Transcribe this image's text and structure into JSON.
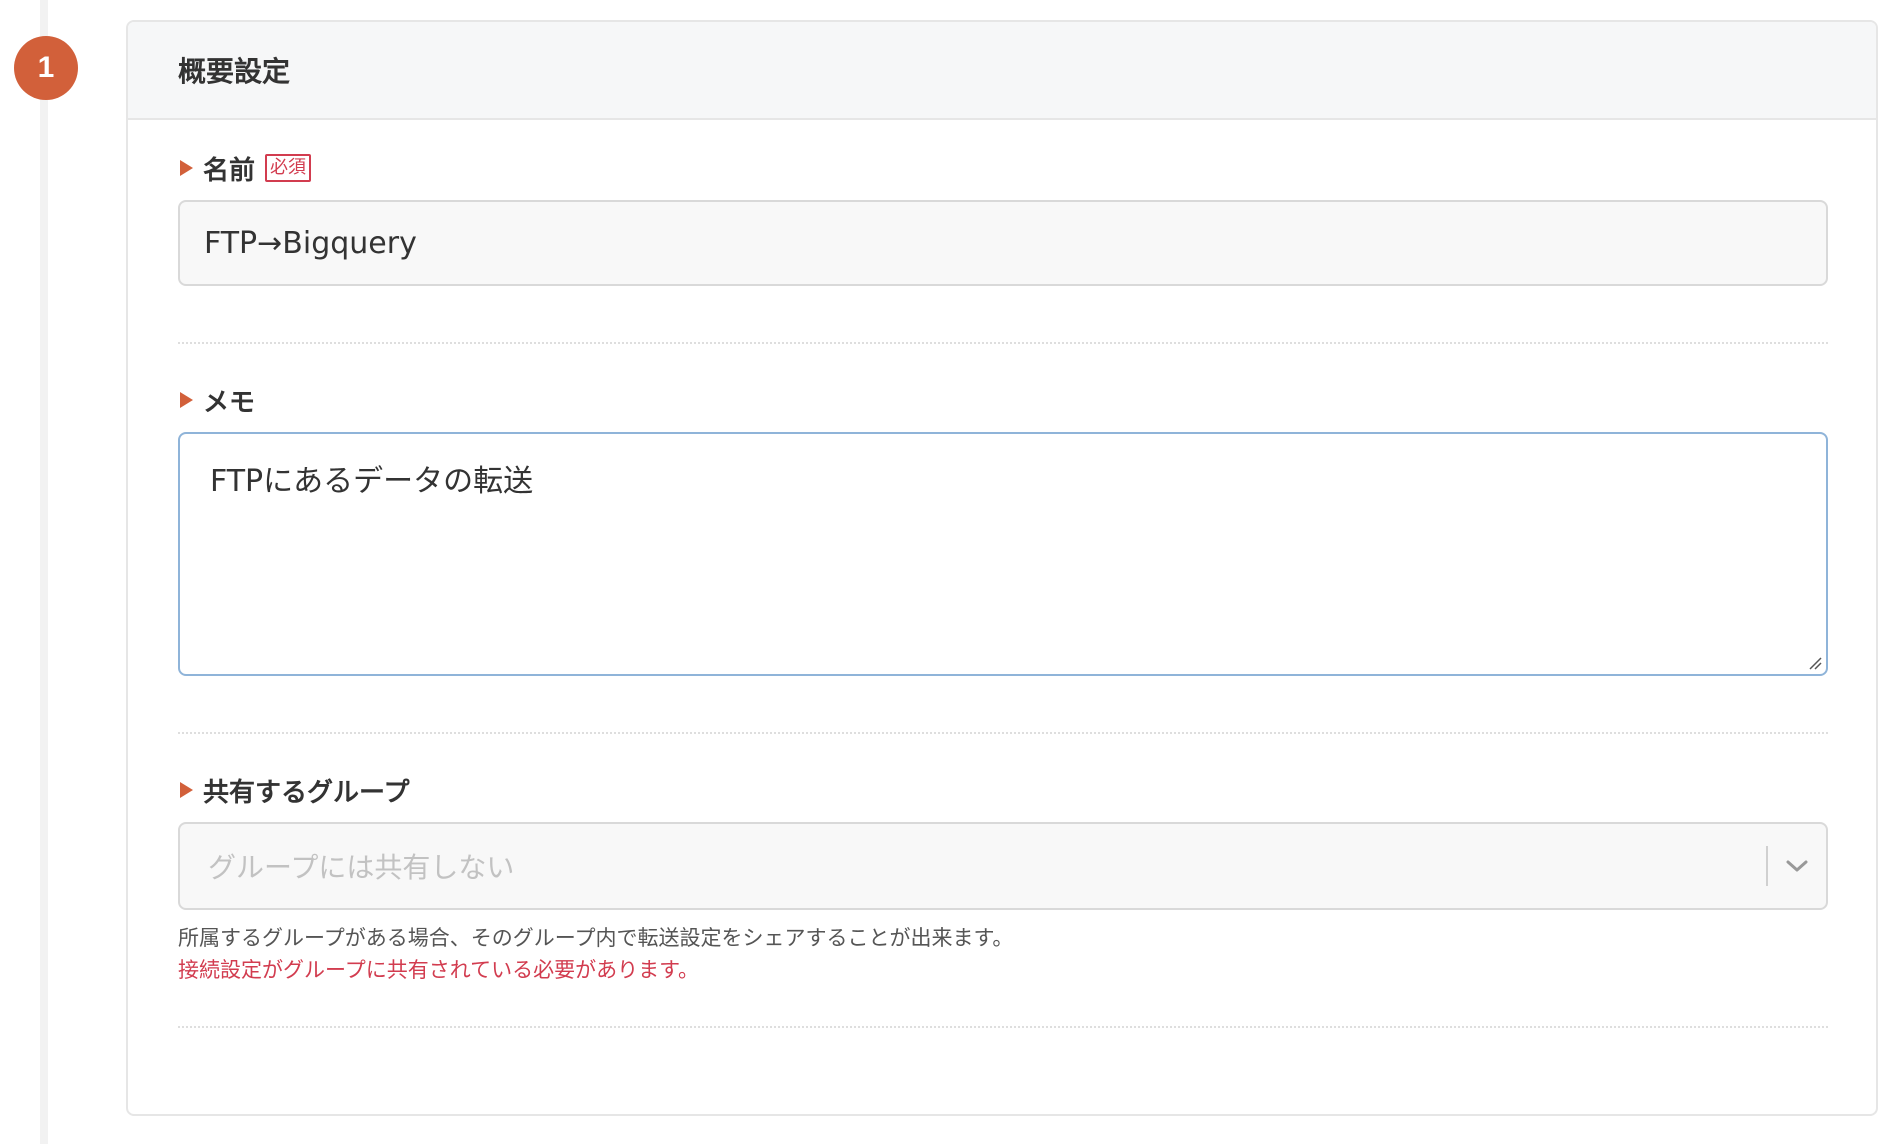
{
  "step": {
    "number": "1"
  },
  "section": {
    "title": "概要設定"
  },
  "fields": {
    "name": {
      "label": "名前",
      "required_badge": "必須",
      "value": "FTP→Bigquery"
    },
    "memo": {
      "label": "メモ",
      "value": "FTPにあるデータの転送"
    },
    "group": {
      "label": "共有するグループ",
      "placeholder": "グループには共有しない",
      "help": "所属するグループがある場合、そのグループ内で転送設定をシェアすることが出来ます。",
      "warning": "接続設定がグループに共有されている必要があります。"
    }
  },
  "colors": {
    "accent": "#d2603a",
    "required": "#d23c4f",
    "focus_border": "#8fb4d9"
  },
  "icons": {
    "marker": "triangle-right-icon",
    "dropdown": "chevron-down-icon",
    "resize": "resize-handle-icon"
  }
}
